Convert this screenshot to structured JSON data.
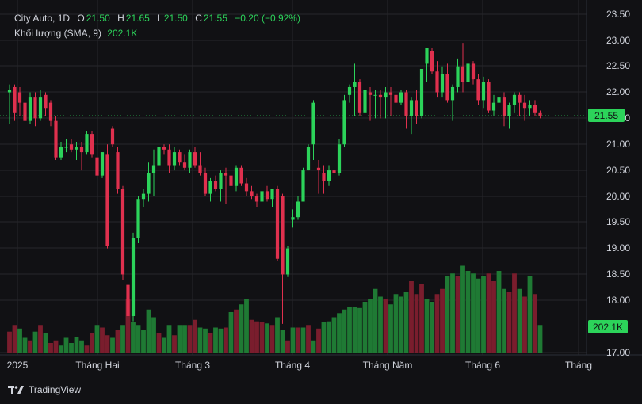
{
  "legend": {
    "symbol": "City Auto, 1D",
    "open_label": "O",
    "open": "21.50",
    "high_label": "H",
    "high": "21.65",
    "low_label": "L",
    "low": "21.50",
    "close_label": "C",
    "close": "21.55",
    "change": "−0.20 (−0.92%)",
    "volume_label": "Khối lượng (SMA, 9)",
    "volume_value": "202.1K"
  },
  "price_tag": "21.55",
  "volume_tag": "202.1K",
  "brand": "TradingView",
  "colors": {
    "up": "#2cd35a",
    "down": "#e0304e",
    "up_volume": "#1f7a34",
    "down_volume": "#7a1d2d",
    "background": "#111114",
    "grid": "#26262b",
    "text": "#d1d4dc",
    "last_price": "#2cd35a"
  },
  "chart_data": {
    "type": "candlestick",
    "title": "City Auto, 1D",
    "x_tick_labels": [
      "2025",
      "Tháng Hai",
      "Tháng 3",
      "Tháng 4",
      "Tháng Năm",
      "Tháng 6",
      "Tháng"
    ],
    "y_tick_labels": [
      "23.50",
      "23.00",
      "22.50",
      "22.00",
      "21.50",
      "21.00",
      "20.50",
      "20.00",
      "19.50",
      "19.00",
      "18.50",
      "18.00",
      "17.00"
    ],
    "ylim": [
      17.0,
      23.5
    ],
    "last_price": 21.55,
    "grid": true,
    "candles": [
      [
        22.0,
        22.15,
        21.4,
        22.05
      ],
      [
        22.1,
        22.15,
        21.45,
        21.6
      ],
      [
        22.0,
        22.1,
        21.55,
        21.8
      ],
      [
        21.8,
        21.9,
        21.4,
        21.45
      ],
      [
        21.45,
        22.0,
        21.4,
        21.9
      ],
      [
        21.9,
        22.0,
        21.35,
        21.5
      ],
      [
        21.5,
        22.05,
        21.45,
        21.9
      ],
      [
        21.95,
        22.0,
        21.55,
        21.7
      ],
      [
        21.8,
        21.85,
        21.35,
        21.45
      ],
      [
        21.45,
        21.55,
        20.7,
        20.75
      ],
      [
        20.75,
        21.05,
        20.7,
        20.95
      ],
      [
        20.95,
        21.1,
        20.85,
        20.95
      ],
      [
        21.0,
        21.1,
        20.85,
        20.9
      ],
      [
        20.9,
        21.05,
        20.7,
        20.95
      ],
      [
        20.95,
        21.05,
        20.5,
        20.85
      ],
      [
        20.85,
        21.25,
        20.8,
        21.2
      ],
      [
        21.2,
        21.25,
        20.75,
        20.8
      ],
      [
        20.75,
        21.0,
        20.35,
        20.4
      ],
      [
        20.4,
        20.85,
        20.35,
        20.85
      ],
      [
        20.8,
        21.0,
        19.0,
        19.05
      ],
      [
        21.3,
        21.35,
        20.95,
        21.0
      ],
      [
        20.85,
        20.95,
        20.05,
        20.15
      ],
      [
        20.15,
        20.2,
        18.4,
        18.5
      ],
      [
        18.3,
        18.4,
        17.65,
        17.7
      ],
      [
        17.7,
        19.3,
        17.6,
        19.2
      ],
      [
        19.2,
        20.0,
        19.1,
        19.95
      ],
      [
        19.95,
        20.15,
        19.8,
        20.05
      ],
      [
        20.05,
        20.65,
        19.9,
        20.45
      ],
      [
        20.45,
        20.9,
        20.0,
        20.6
      ],
      [
        20.6,
        21.0,
        20.5,
        20.95
      ],
      [
        20.95,
        21.0,
        20.8,
        20.9
      ],
      [
        20.9,
        21.0,
        20.45,
        20.6
      ],
      [
        20.6,
        20.95,
        20.5,
        20.85
      ],
      [
        20.85,
        20.9,
        20.6,
        20.65
      ],
      [
        20.65,
        20.8,
        20.5,
        20.55
      ],
      [
        20.55,
        20.9,
        20.45,
        20.85
      ],
      [
        20.85,
        20.95,
        20.55,
        20.6
      ],
      [
        20.6,
        20.85,
        20.4,
        20.45
      ],
      [
        20.45,
        20.55,
        20.0,
        20.05
      ],
      [
        20.05,
        20.35,
        19.9,
        20.3
      ],
      [
        20.3,
        20.4,
        20.1,
        20.15
      ],
      [
        20.15,
        20.5,
        19.9,
        20.45
      ],
      [
        20.45,
        20.55,
        19.85,
        20.4
      ],
      [
        20.4,
        20.55,
        20.1,
        20.2
      ],
      [
        20.2,
        20.6,
        20.1,
        20.55
      ],
      [
        20.55,
        20.6,
        20.2,
        20.25
      ],
      [
        20.25,
        20.35,
        20.0,
        20.1
      ],
      [
        20.1,
        20.2,
        19.95,
        20.0
      ],
      [
        20.0,
        20.05,
        19.8,
        19.9
      ],
      [
        19.9,
        20.15,
        19.8,
        20.1
      ],
      [
        20.1,
        20.2,
        19.9,
        19.95
      ],
      [
        19.95,
        20.15,
        19.8,
        20.15
      ],
      [
        20.15,
        20.2,
        18.75,
        18.8
      ],
      [
        20.0,
        20.05,
        17.55,
        18.5
      ],
      [
        18.5,
        19.05,
        18.45,
        19.0
      ],
      [
        19.55,
        19.75,
        19.4,
        19.6
      ],
      [
        19.6,
        20.0,
        19.55,
        19.9
      ],
      [
        19.9,
        20.55,
        19.9,
        20.5
      ],
      [
        20.5,
        21.0,
        20.5,
        20.95
      ],
      [
        21.0,
        21.85,
        20.7,
        21.8
      ],
      [
        20.55,
        20.7,
        20.05,
        20.5
      ],
      [
        20.45,
        20.6,
        20.05,
        20.3
      ],
      [
        20.3,
        20.6,
        20.2,
        20.5
      ],
      [
        20.5,
        20.65,
        20.3,
        20.45
      ],
      [
        20.45,
        21.1,
        20.4,
        21.0
      ],
      [
        21.0,
        21.95,
        20.95,
        21.85
      ],
      [
        21.95,
        22.15,
        21.8,
        22.1
      ],
      [
        22.1,
        22.55,
        21.55,
        22.2
      ],
      [
        22.2,
        22.25,
        21.55,
        21.6
      ],
      [
        21.6,
        22.15,
        21.5,
        22.05
      ],
      [
        22.0,
        22.1,
        21.45,
        21.95
      ],
      [
        21.95,
        22.05,
        21.5,
        21.95
      ],
      [
        21.95,
        22.05,
        21.5,
        21.9
      ],
      [
        21.9,
        22.1,
        21.5,
        22.0
      ],
      [
        22.0,
        22.1,
        21.55,
        21.95
      ],
      [
        21.95,
        22.1,
        21.6,
        21.8
      ],
      [
        21.8,
        22.05,
        21.75,
        22.0
      ],
      [
        22.0,
        22.05,
        21.3,
        21.55
      ],
      [
        21.55,
        21.9,
        21.2,
        21.85
      ],
      [
        21.85,
        22.05,
        21.4,
        21.55
      ],
      [
        21.55,
        22.45,
        21.5,
        22.45
      ],
      [
        22.55,
        22.85,
        22.2,
        22.85
      ],
      [
        22.8,
        22.85,
        22.35,
        22.4
      ],
      [
        22.4,
        22.6,
        21.9,
        22.0
      ],
      [
        22.0,
        22.5,
        21.9,
        22.35
      ],
      [
        22.35,
        22.55,
        21.8,
        21.85
      ],
      [
        21.85,
        22.15,
        21.45,
        22.1
      ],
      [
        22.1,
        22.65,
        22.0,
        22.5
      ],
      [
        22.5,
        22.95,
        22.0,
        22.2
      ],
      [
        22.2,
        22.6,
        22.05,
        22.55
      ],
      [
        22.55,
        22.6,
        22.15,
        22.25
      ],
      [
        22.25,
        22.35,
        21.75,
        21.85
      ],
      [
        21.85,
        22.3,
        21.7,
        22.2
      ],
      [
        22.2,
        22.25,
        21.6,
        21.65
      ],
      [
        21.65,
        21.95,
        21.55,
        21.8
      ],
      [
        21.8,
        21.95,
        21.45,
        21.9
      ],
      [
        21.9,
        22.0,
        21.35,
        21.55
      ],
      [
        21.55,
        21.8,
        21.3,
        21.75
      ],
      [
        21.75,
        22.0,
        21.6,
        21.95
      ],
      [
        21.95,
        22.0,
        21.55,
        21.8
      ],
      [
        21.8,
        21.95,
        21.45,
        21.7
      ],
      [
        21.7,
        21.85,
        21.55,
        21.75
      ],
      [
        21.75,
        21.85,
        21.55,
        21.6
      ],
      [
        21.6,
        21.65,
        21.5,
        21.55
      ]
    ],
    "volume": [
      [
        0.42,
        0
      ],
      [
        0.55,
        0
      ],
      [
        0.48,
        1
      ],
      [
        0.3,
        1
      ],
      [
        0.25,
        0
      ],
      [
        0.42,
        1
      ],
      [
        0.55,
        0
      ],
      [
        0.4,
        1
      ],
      [
        0.2,
        0
      ],
      [
        0.25,
        0
      ],
      [
        0.15,
        1
      ],
      [
        0.3,
        1
      ],
      [
        0.2,
        1
      ],
      [
        0.32,
        1
      ],
      [
        0.25,
        1
      ],
      [
        0.15,
        0
      ],
      [
        0.4,
        0
      ],
      [
        0.55,
        1
      ],
      [
        0.5,
        0
      ],
      [
        0.35,
        0
      ],
      [
        0.3,
        1
      ],
      [
        0.45,
        0
      ],
      [
        0.55,
        1
      ],
      [
        1.05,
        0
      ],
      [
        0.6,
        1
      ],
      [
        0.55,
        1
      ],
      [
        0.45,
        1
      ],
      [
        0.85,
        1
      ],
      [
        0.7,
        1
      ],
      [
        0.4,
        0
      ],
      [
        0.3,
        1
      ],
      [
        0.55,
        1
      ],
      [
        0.35,
        0
      ],
      [
        0.55,
        1
      ],
      [
        0.55,
        1
      ],
      [
        0.55,
        0
      ],
      [
        0.65,
        0
      ],
      [
        0.5,
        1
      ],
      [
        0.48,
        1
      ],
      [
        0.4,
        0
      ],
      [
        0.5,
        1
      ],
      [
        0.48,
        1
      ],
      [
        0.5,
        0
      ],
      [
        0.8,
        1
      ],
      [
        0.85,
        0
      ],
      [
        0.95,
        1
      ],
      [
        1.05,
        1
      ],
      [
        0.65,
        0
      ],
      [
        0.62,
        0
      ],
      [
        0.6,
        0
      ],
      [
        0.58,
        1
      ],
      [
        0.55,
        0
      ],
      [
        0.7,
        1
      ],
      [
        0.45,
        1
      ],
      [
        0.25,
        0
      ],
      [
        0.5,
        1
      ],
      [
        0.5,
        0
      ],
      [
        0.5,
        1
      ],
      [
        0.55,
        0
      ],
      [
        0.25,
        1
      ],
      [
        0.48,
        0
      ],
      [
        0.6,
        1
      ],
      [
        0.62,
        1
      ],
      [
        0.7,
        1
      ],
      [
        0.78,
        1
      ],
      [
        0.85,
        1
      ],
      [
        0.9,
        1
      ],
      [
        0.9,
        1
      ],
      [
        0.88,
        1
      ],
      [
        1.0,
        1
      ],
      [
        1.05,
        1
      ],
      [
        1.25,
        1
      ],
      [
        1.1,
        1
      ],
      [
        1.05,
        0
      ],
      [
        0.95,
        1
      ],
      [
        1.15,
        1
      ],
      [
        1.1,
        1
      ],
      [
        1.2,
        1
      ],
      [
        1.4,
        0
      ],
      [
        1.15,
        0
      ],
      [
        1.35,
        0
      ],
      [
        1.05,
        1
      ],
      [
        1.0,
        1
      ],
      [
        1.15,
        0
      ],
      [
        1.25,
        0
      ],
      [
        1.5,
        1
      ],
      [
        1.55,
        1
      ],
      [
        1.5,
        0
      ],
      [
        1.7,
        1
      ],
      [
        1.6,
        1
      ],
      [
        1.55,
        1
      ],
      [
        1.45,
        1
      ],
      [
        1.5,
        1
      ],
      [
        1.55,
        0
      ],
      [
        1.4,
        0
      ],
      [
        1.6,
        1
      ],
      [
        1.25,
        1
      ],
      [
        1.2,
        0
      ],
      [
        1.55,
        0
      ],
      [
        1.25,
        1
      ],
      [
        1.1,
        0
      ],
      [
        1.5,
        1
      ],
      [
        1.15,
        0
      ],
      [
        0.55,
        1
      ]
    ]
  }
}
